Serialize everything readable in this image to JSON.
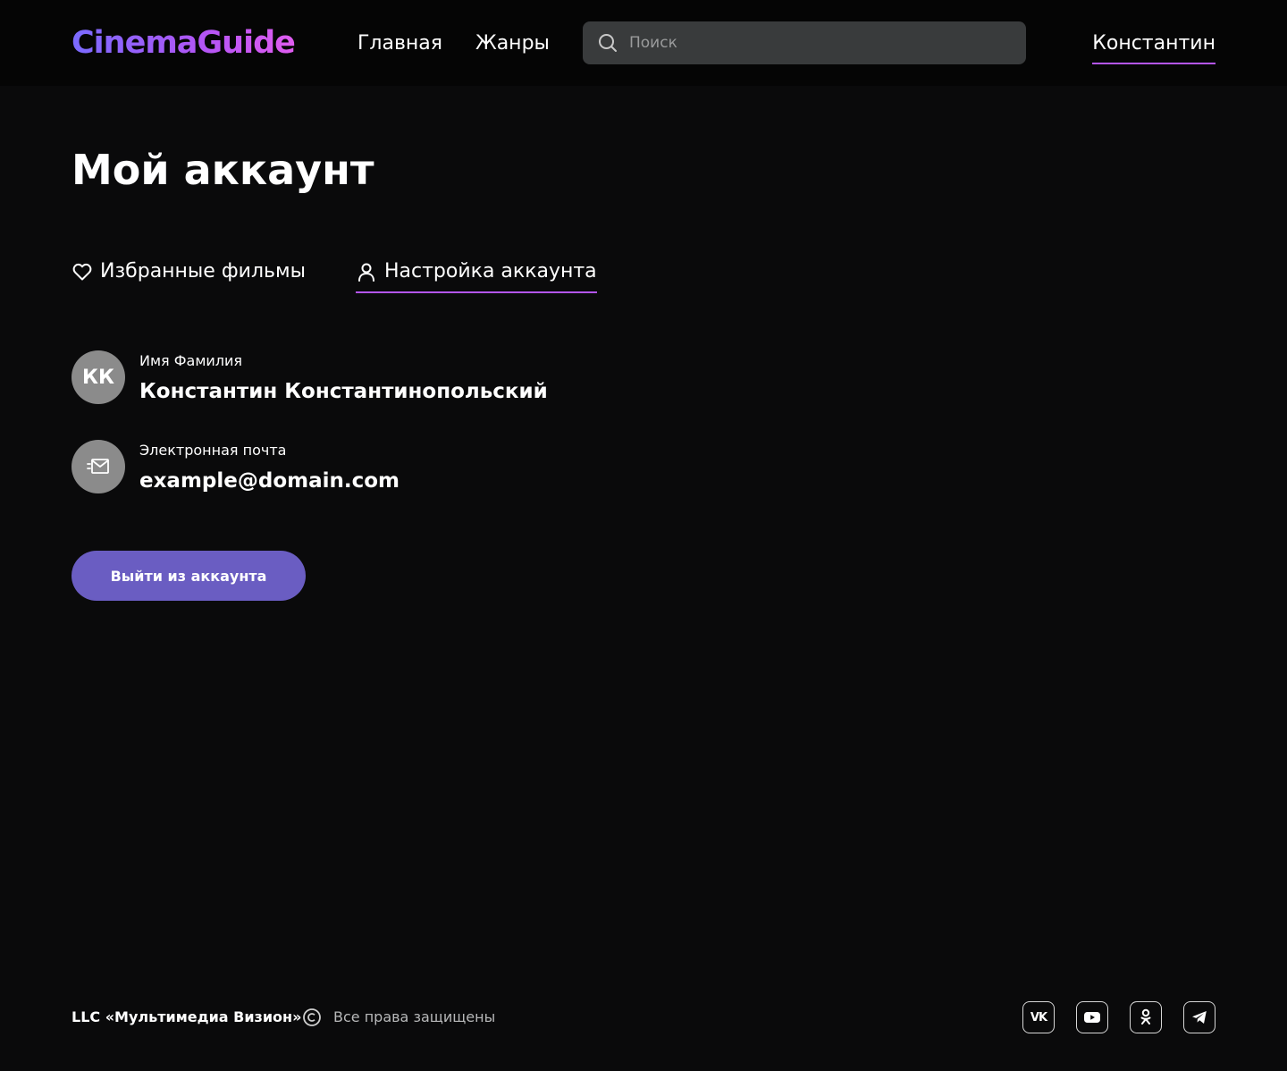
{
  "header": {
    "logo": "CinemaGuide",
    "nav": [
      {
        "label": "Главная"
      },
      {
        "label": "Жанры"
      }
    ],
    "search": {
      "placeholder": "Поиск",
      "value": ""
    },
    "user_name": "Константин"
  },
  "page": {
    "title": "Мой аккаунт",
    "tabs": [
      {
        "label": "Избранные фильмы",
        "icon": "heart-icon",
        "active": false
      },
      {
        "label": "Настройка аккаунта",
        "icon": "user-icon",
        "active": true
      }
    ]
  },
  "account": {
    "name": {
      "label": "Имя Фамилия",
      "value": "Константин Константинопольский",
      "initials": "КК"
    },
    "email": {
      "label": "Электронная почта",
      "value": "example@domain.com",
      "icon": "mail-icon"
    }
  },
  "logout_label": "Выйти из аккаунта",
  "footer": {
    "company": "LLC «Мультимедиа Визион»",
    "rights": "Все права защищены",
    "social": [
      {
        "name": "vk",
        "text": "VK"
      },
      {
        "name": "youtube"
      },
      {
        "name": "odnoklassniki"
      },
      {
        "name": "telegram"
      }
    ]
  },
  "colors": {
    "background": "#0a0a0b",
    "header": "#050505",
    "accent": "#b455f5",
    "button": "#6a5dc2",
    "avatar": "#8b8b8b",
    "search_bg": "#393b3c"
  }
}
